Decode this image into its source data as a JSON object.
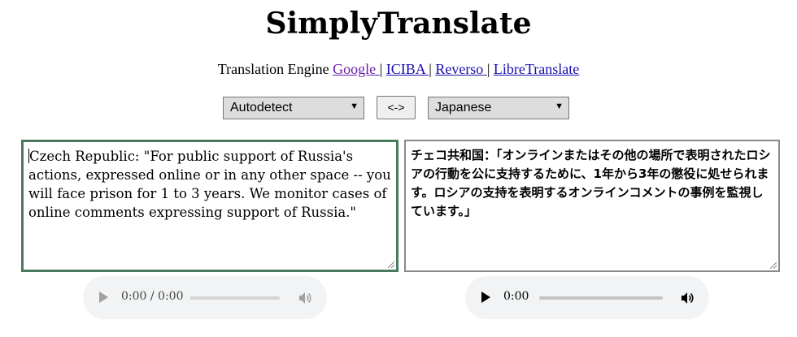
{
  "app": {
    "title": "SimplyTranslate"
  },
  "engines": {
    "prefix": "Translation Engine",
    "items": [
      {
        "label": "Google",
        "visited": true
      },
      {
        "label": "ICIBA",
        "visited": false
      },
      {
        "label": "Reverso",
        "visited": false
      },
      {
        "label": "LibreTranslate",
        "visited": false
      }
    ],
    "separator": "|"
  },
  "controls": {
    "source_language": "Autodetect",
    "swap_label": "<->",
    "target_language": "Japanese"
  },
  "source": {
    "text": "Czech Republic: \"For public support of Russia's actions, expressed online or in any other space -- you will face prison for 1 to 3 years. We monitor cases of online comments expressing support of Russia.\""
  },
  "output": {
    "text": "チェコ共和国：「オンラインまたはその他の場所で表明されたロシアの行動を公に支持するために、1年から3年の懲役に処せられます。ロシアの支持を表明するオンラインコメントの事例を監視しています。」"
  },
  "audio_source": {
    "time": "0:00 / 0:00",
    "enabled": false
  },
  "audio_target": {
    "time": "0:00",
    "enabled": true
  },
  "colors": {
    "link": "#1a0dab",
    "visited_link": "#681da8",
    "focus_border": "#4a7a5e",
    "select_bg": "#dddddd"
  }
}
